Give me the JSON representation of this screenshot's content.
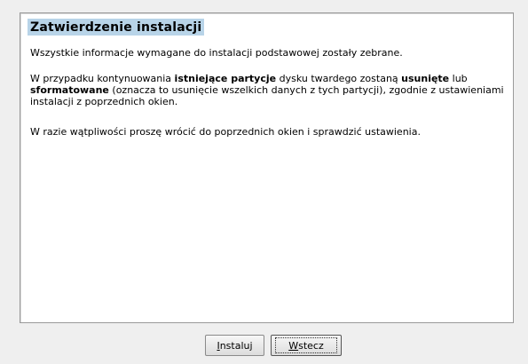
{
  "dialog": {
    "title": "Zatwierdzenie instalacji",
    "para1": "Wszystkie informacje wymagane do instalacji podstawowej zostały zebrane.",
    "para2": {
      "t1": "W przypadku kontynuowania ",
      "b1": "istniejące partycje",
      "t2": " dysku twardego zostaną ",
      "b2": "usunięte",
      "t3": " lub ",
      "b3": "sformatowane",
      "t4": " (oznacza to usunięcie wszelkich danych z tych partycji), zgodnie z ustawieniami instalacji z poprzednich okien."
    },
    "para3": "W razie wątpliwości proszę wrócić do poprzednich okien i sprawdzić ustawienia."
  },
  "buttons": {
    "install": {
      "mnemonic": "I",
      "rest": "nstaluj"
    },
    "back": {
      "mnemonic": "W",
      "rest": "stecz"
    }
  },
  "colors": {
    "title_highlight": "#b8d4e8",
    "window_bg": "#efefef",
    "panel_bg": "#ffffff"
  }
}
